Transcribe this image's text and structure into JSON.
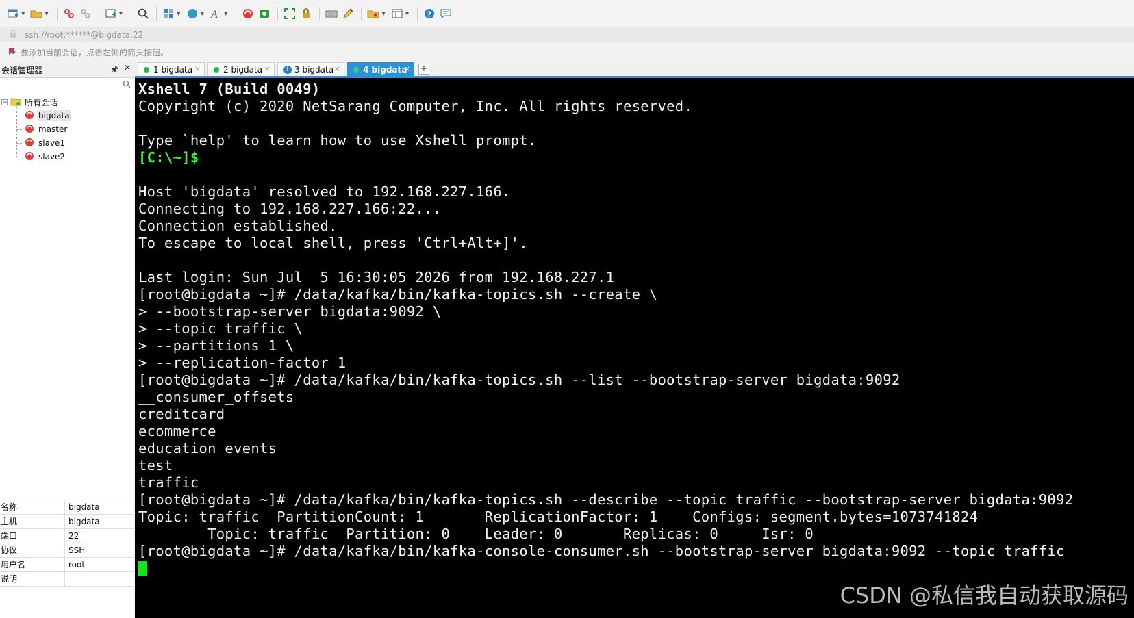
{
  "toolbar": {
    "icons": [
      "new-session-icon",
      "open-folder-icon",
      "disconnect-icon",
      "reconnect-icon",
      "new-window-icon",
      "find-icon",
      "properties-icon",
      "globe-icon",
      "font-icon",
      "xftp-icon",
      "xmanager-icon",
      "fullscreen-icon",
      "lock-icon",
      "keyboard-icon",
      "compose-icon",
      "new-tab-icon",
      "layout-icon",
      "help-icon",
      "chat-icon"
    ]
  },
  "address": {
    "text": "ssh://root:******@bigdata:22"
  },
  "hint": {
    "text": "要添加当前会话，点击左侧的箭头按钮。"
  },
  "session_panel": {
    "title": "会话管理器",
    "pin": "🖈",
    "close": "✕",
    "root_label": "所有会话",
    "sessions": [
      {
        "label": "bigdata",
        "selected": true
      },
      {
        "label": "master",
        "selected": false
      },
      {
        "label": "slave1",
        "selected": false
      },
      {
        "label": "slave2",
        "selected": false
      }
    ],
    "properties": [
      {
        "key": "名称",
        "value": "bigdata"
      },
      {
        "key": "主机",
        "value": "bigdata"
      },
      {
        "key": "端口",
        "value": "22"
      },
      {
        "key": "协议",
        "value": "SSH"
      },
      {
        "key": "用户名",
        "value": "root"
      },
      {
        "key": "说明",
        "value": ""
      }
    ]
  },
  "tabs": [
    {
      "label": "1 bigdata",
      "status": "connected",
      "active": false
    },
    {
      "label": "2 bigdata",
      "status": "connected",
      "active": false
    },
    {
      "label": "3 bigdata",
      "status": "info",
      "active": false
    },
    {
      "label": "4 bigdata",
      "status": "connected",
      "active": true
    }
  ],
  "tab_add": "+",
  "tab_close": "×",
  "terminal": {
    "lines": [
      {
        "text": "Xshell 7 (Build 0049)",
        "style": "bold"
      },
      {
        "text": "Copyright (c) 2020 NetSarang Computer, Inc. All rights reserved.",
        "style": ""
      },
      {
        "text": "",
        "style": ""
      },
      {
        "text": "Type `help' to learn how to use Xshell prompt.",
        "style": ""
      },
      {
        "text": "[C:\\~]$",
        "style": "green"
      },
      {
        "text": "",
        "style": ""
      },
      {
        "text": "Host 'bigdata' resolved to 192.168.227.166.",
        "style": ""
      },
      {
        "text": "Connecting to 192.168.227.166:22...",
        "style": ""
      },
      {
        "text": "Connection established.",
        "style": ""
      },
      {
        "text": "To escape to local shell, press 'Ctrl+Alt+]'.",
        "style": ""
      },
      {
        "text": "",
        "style": ""
      },
      {
        "text": "Last login: Sun Jul  5 16:30:05 2026 from 192.168.227.1",
        "style": ""
      },
      {
        "text": "[root@bigdata ~]# /data/kafka/bin/kafka-topics.sh --create \\",
        "style": ""
      },
      {
        "text": "> --bootstrap-server bigdata:9092 \\",
        "style": ""
      },
      {
        "text": "> --topic traffic \\",
        "style": ""
      },
      {
        "text": "> --partitions 1 \\",
        "style": ""
      },
      {
        "text": "> --replication-factor 1",
        "style": ""
      },
      {
        "text": "[root@bigdata ~]# /data/kafka/bin/kafka-topics.sh --list --bootstrap-server bigdata:9092",
        "style": ""
      },
      {
        "text": "__consumer_offsets",
        "style": ""
      },
      {
        "text": "creditcard",
        "style": ""
      },
      {
        "text": "ecommerce",
        "style": ""
      },
      {
        "text": "education_events",
        "style": ""
      },
      {
        "text": "test",
        "style": ""
      },
      {
        "text": "traffic",
        "style": ""
      },
      {
        "text": "[root@bigdata ~]# /data/kafka/bin/kafka-topics.sh --describe --topic traffic --bootstrap-server bigdata:9092",
        "style": ""
      },
      {
        "text": "Topic: traffic  PartitionCount: 1       ReplicationFactor: 1    Configs: segment.bytes=1073741824",
        "style": ""
      },
      {
        "text": "        Topic: traffic  Partition: 0    Leader: 0       Replicas: 0     Isr: 0",
        "style": ""
      },
      {
        "text": "[root@bigdata ~]# /data/kafka/bin/kafka-console-consumer.sh --bootstrap-server bigdata:9092 --topic traffic",
        "style": ""
      }
    ]
  },
  "watermark": "CSDN @私信我自动获取源码",
  "colors": {
    "accent": "#2a91d6",
    "terminal_bg": "#000000",
    "terminal_fg": "#f2f2f2",
    "prompt_green": "#3ff23f",
    "cursor": "#17e517",
    "status_connected": "#1fb84a"
  }
}
